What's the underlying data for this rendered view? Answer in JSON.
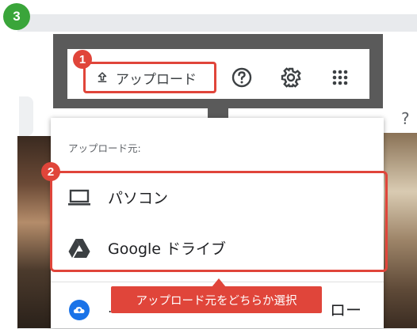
{
  "step_number": "3",
  "toolbar": {
    "badge": "1",
    "upload_label": "アップロード",
    "icons": [
      "upload-icon",
      "help-icon",
      "gear-icon",
      "apps-grid-icon"
    ]
  },
  "background": {
    "help_glyph": "?"
  },
  "menu": {
    "heading": "アップロード元:",
    "badge": "2",
    "options": [
      {
        "icon": "laptop-icon",
        "label": "パソコン"
      },
      {
        "icon": "google-drive-icon",
        "label": "Google ドライブ"
      }
    ],
    "bottom_snippet": "…",
    "bottom_text": "ロー"
  },
  "callout": "アップロード元をどちらか選択",
  "colors": {
    "accent_red": "#e0453a",
    "step_green": "#3aa53a",
    "callout_gray": "#5a5a5a",
    "cloud_blue": "#1a73e8"
  }
}
